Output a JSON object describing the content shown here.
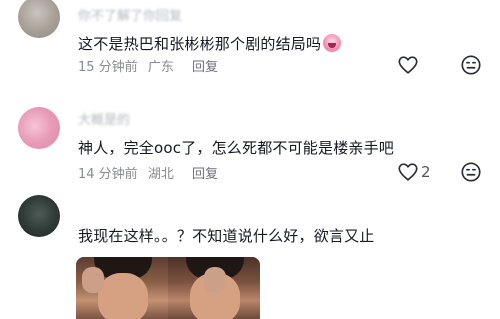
{
  "comments": [
    {
      "username": "你不了解了你回复",
      "text": "这不是热巴和张彬彬那个剧的结局吗",
      "emoji_icon": "crying-face-emoji-icon",
      "time": "15 分钟前",
      "location": "广东",
      "reply_label": "回复",
      "like_count": ""
    },
    {
      "username": "大概是的",
      "text": "神人，完全ooc了，怎么死都不可能是楼亲手吧",
      "time": "14 分钟前",
      "location": "湖北",
      "reply_label": "回复",
      "like_count": "2"
    },
    {
      "username": "",
      "text": "我现在这样。。？不知道说什么好，欲言又止"
    }
  ],
  "colors": {
    "text": "#161823",
    "meta": "#8a8b91",
    "username": "#b6b8be"
  },
  "icons": [
    "heart-outline-icon",
    "dislike-face-icon"
  ]
}
